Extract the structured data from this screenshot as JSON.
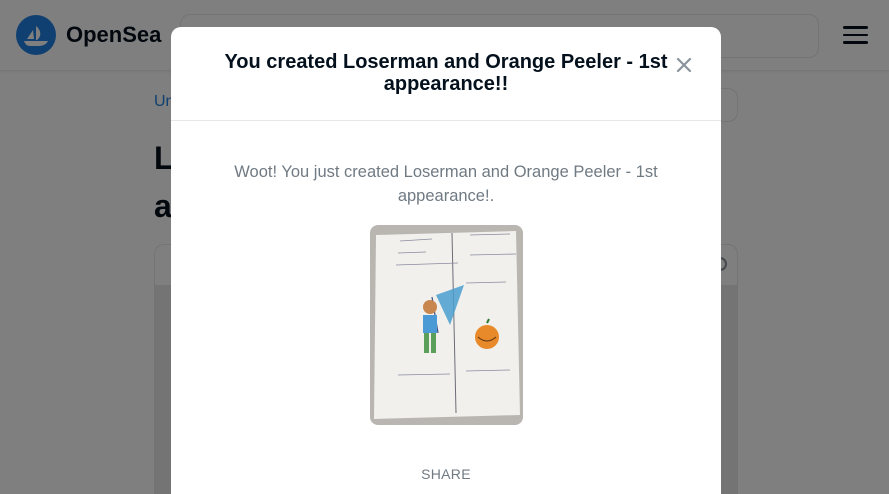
{
  "navbar": {
    "brand": "OpenSea",
    "logo_icon": "opensea-boat-logo",
    "menu_icon": "hamburger-menu-icon"
  },
  "background": {
    "breadcrumb_fragment": "Un",
    "title_fragment": "Lo\na"
  },
  "modal": {
    "title": "You created Loserman and Orange Peeler - 1st appearance!!",
    "message": "Woot! You just created Loserman and Orange Peeler - 1st appearance!.",
    "image_alt": "Hand-drawn picture of Loserman holding a blue net next to an orange pumpkin character",
    "share_label": "SHARE",
    "close_icon": "close-icon"
  },
  "colors": {
    "accent": "#2081e2",
    "text_dark": "#04111d",
    "text_muted": "#707a83",
    "overlay": "rgba(0,0,0,0.5)"
  }
}
